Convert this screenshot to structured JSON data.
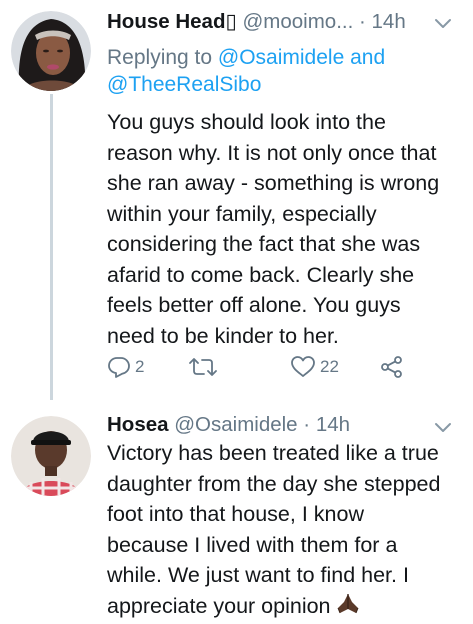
{
  "tweets": [
    {
      "display_name": "House Head▯",
      "handle": "@mooimo...",
      "separator": "·",
      "time": "14h",
      "reply_prefix": "Replying to",
      "reply_mentions_1": "@Osaimidele and",
      "reply_mentions_2": "@TheeRealSibo",
      "text_lines": [
        "You guys should look into the",
        "reason why. It is not only once that",
        "she ran away - something is wrong",
        "within your family, especially",
        "considering the fact that she was",
        "afarid to come back. Clearly she",
        "feels better off alone. You guys",
        "need to be kinder to her."
      ],
      "reply_count": "2",
      "retweet_count": "",
      "like_count": "22",
      "icons": [
        "reply-icon",
        "retweet-icon",
        "like-icon",
        "share-icon",
        "chevron-down-icon"
      ]
    },
    {
      "display_name": "Hosea",
      "handle": "@Osaimidele",
      "separator": "·",
      "time": "14h",
      "text_lines": [
        "Victory has been treated like a true",
        "daughter from the day she stepped",
        "foot into that house, I know",
        "because I lived with them for a",
        "while. We just want to find her. I",
        "appreciate your opinion"
      ],
      "emoji": "folded-hands-emoji",
      "icons": [
        "chevron-down-icon"
      ]
    }
  ],
  "colors": {
    "text": "#14171a",
    "secondary": "#657786",
    "link": "#1da1f2",
    "thread_line": "#ccd6dd"
  }
}
